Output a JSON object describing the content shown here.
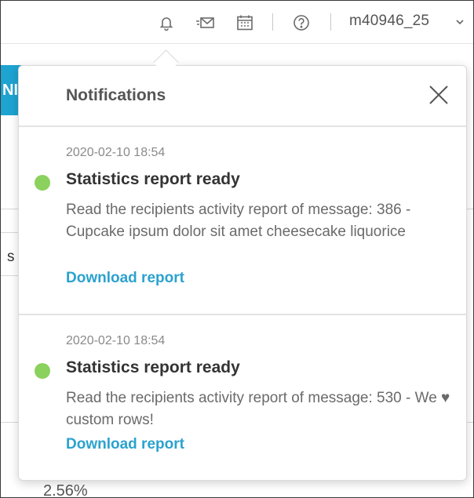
{
  "header": {
    "user_label": "m40946_25",
    "icons": [
      "bell-icon",
      "mail-send-icon",
      "calendar-icon",
      "help-icon",
      "chevron-down-icon"
    ]
  },
  "background": {
    "tab_text": "NI",
    "left_text": "s",
    "percent_text": "2.56%"
  },
  "notifications_panel": {
    "title": "Notifications",
    "items": [
      {
        "timestamp": "2020-02-10 18:54",
        "title": "Statistics report ready",
        "body": "Read the recipients activity report of message: 386 - Cupcake ipsum dolor sit amet cheesecake liquorice",
        "action": "Download report",
        "status_color": "#8bd15d"
      },
      {
        "timestamp": "2020-02-10 18:54",
        "title": "Statistics report ready",
        "body": "Read the recipients activity report of message: 530 - We ♥ custom rows!",
        "action": "Download report",
        "status_color": "#8bd15d"
      }
    ]
  },
  "colors": {
    "accent_link": "#2ba2cf",
    "tab_blue": "#1fa3d1",
    "unread_dot": "#8bd15d"
  }
}
